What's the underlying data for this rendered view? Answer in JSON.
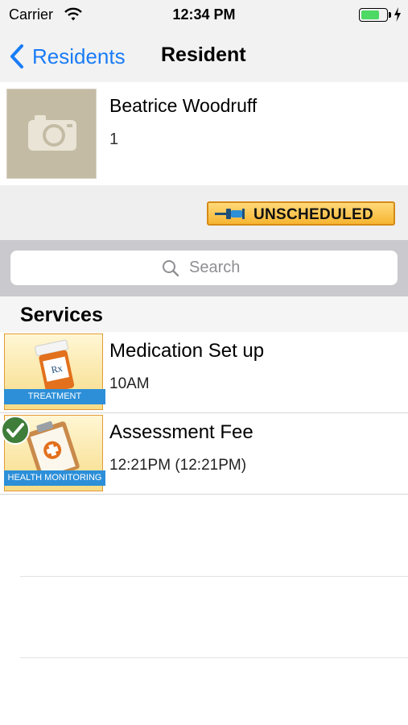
{
  "status_bar": {
    "carrier": "Carrier",
    "time": "12:34 PM",
    "battery_level": 0.75,
    "battery_color": "#4cd964"
  },
  "nav": {
    "back_label": "Residents",
    "title": "Resident",
    "accent_color": "#1a7cf6"
  },
  "resident": {
    "name": "Beatrice Woodruff",
    "room": "1",
    "photo_icon": "camera-icon"
  },
  "actions": {
    "unscheduled_label": "UNSCHEDULED",
    "unscheduled_icon": "pin-icon"
  },
  "search": {
    "placeholder": "Search"
  },
  "services": {
    "header": "Services",
    "items": [
      {
        "name": "Medication Set up",
        "time": "10AM",
        "category": "TREATMENT",
        "icon": "medication-bottle-icon",
        "completed": false
      },
      {
        "name": "Assessment Fee",
        "time": "12:21PM (12:21PM)",
        "category": "HEALTH MONITORING",
        "icon": "clipboard-icon",
        "completed": true
      }
    ]
  }
}
